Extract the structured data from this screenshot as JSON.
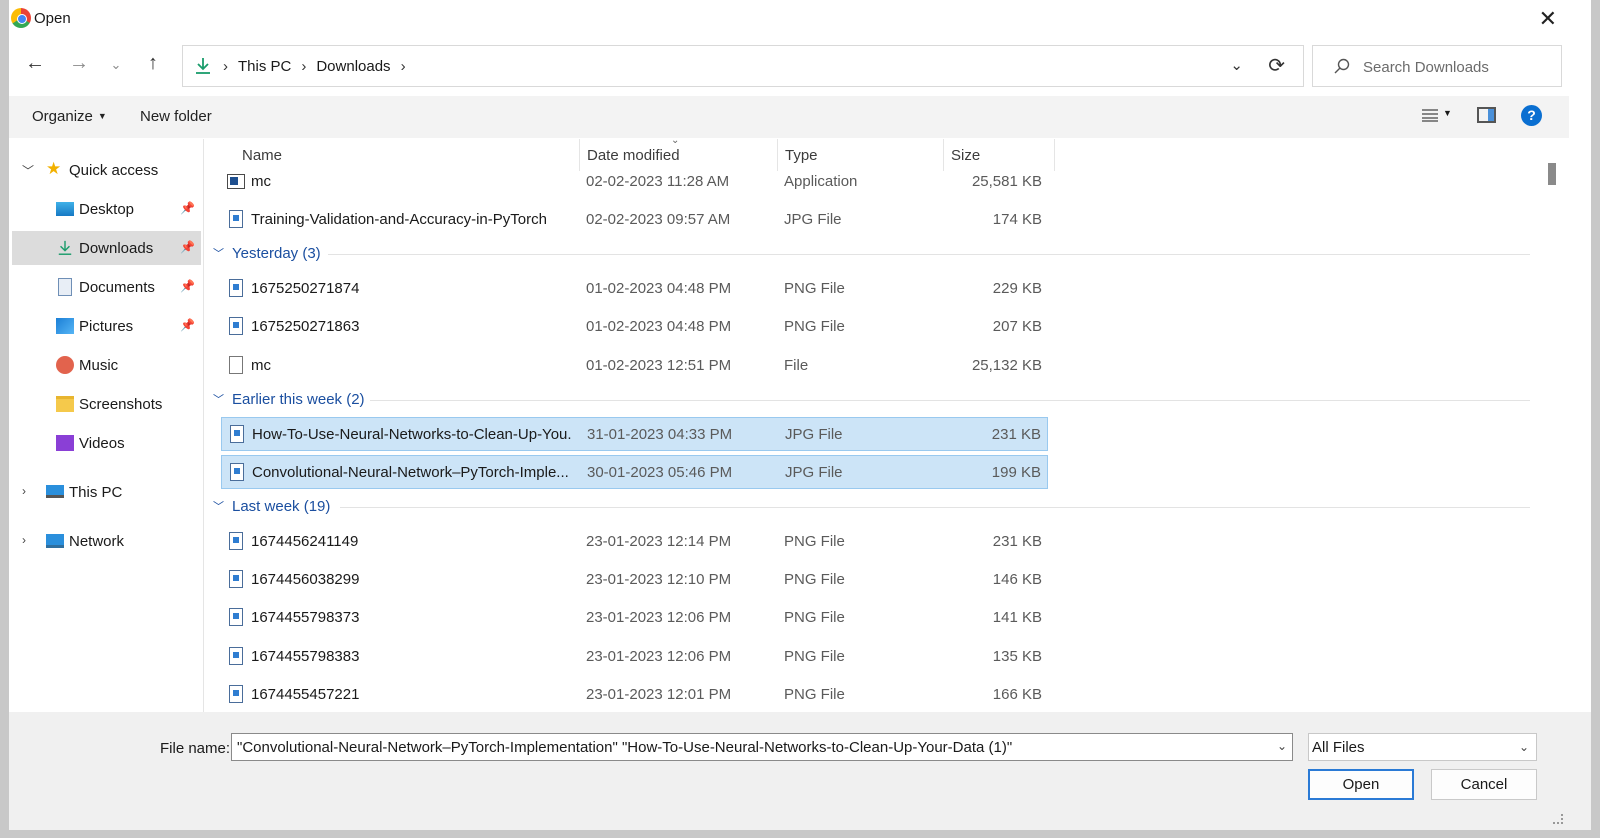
{
  "window": {
    "title": "Open",
    "close_icon": "close-icon"
  },
  "nav": {
    "breadcrumbs": [
      "This PC",
      "Downloads"
    ],
    "search_placeholder": "Search Downloads"
  },
  "toolbar": {
    "organize_label": "Organize",
    "new_folder_label": "New folder",
    "help_label": "?"
  },
  "sidebar": {
    "quick_access": "Quick access",
    "items": [
      {
        "label": "Desktop",
        "icon": "desktop-icon",
        "pinned": true
      },
      {
        "label": "Downloads",
        "icon": "download-icon",
        "pinned": true,
        "selected": true
      },
      {
        "label": "Documents",
        "icon": "document-icon",
        "pinned": true
      },
      {
        "label": "Pictures",
        "icon": "pictures-icon",
        "pinned": true
      },
      {
        "label": "Music",
        "icon": "music-icon",
        "pinned": false
      },
      {
        "label": "Screenshots",
        "icon": "folder-icon",
        "pinned": false
      },
      {
        "label": "Videos",
        "icon": "videos-icon",
        "pinned": false
      }
    ],
    "this_pc": "This PC",
    "network": "Network"
  },
  "columns": {
    "name": "Name",
    "date": "Date modified",
    "type": "Type",
    "size": "Size"
  },
  "top_rows": [
    {
      "name": "mc",
      "date": "02-02-2023 11:28 AM",
      "type": "Application",
      "size": "25,581 KB",
      "icon": "application-icon"
    },
    {
      "name": "Training-Validation-and-Accuracy-in-PyTorch",
      "date": "02-02-2023 09:57 AM",
      "type": "JPG File",
      "size": "174 KB",
      "icon": "image-file-icon"
    }
  ],
  "groups": {
    "yesterday": {
      "label": "Yesterday (3)",
      "rows": [
        {
          "name": "1675250271874",
          "date": "01-02-2023 04:48 PM",
          "type": "PNG File",
          "size": "229 KB",
          "icon": "image-file-icon"
        },
        {
          "name": "1675250271863",
          "date": "01-02-2023 04:48 PM",
          "type": "PNG File",
          "size": "207 KB",
          "icon": "image-file-icon"
        },
        {
          "name": "mc",
          "date": "01-02-2023 12:51 PM",
          "type": "File",
          "size": "25,132 KB",
          "icon": "blank-file-icon"
        }
      ]
    },
    "earlier": {
      "label": "Earlier this week (2)",
      "rows": [
        {
          "name": "How-To-Use-Neural-Networks-to-Clean-Up-You...",
          "date": "31-01-2023 04:33 PM",
          "type": "JPG File",
          "size": "231 KB",
          "icon": "image-file-icon",
          "selected": true
        },
        {
          "name": "Convolutional-Neural-Network–PyTorch-Imple...",
          "date": "30-01-2023 05:46 PM",
          "type": "JPG File",
          "size": "199 KB",
          "icon": "image-file-icon",
          "selected": true
        }
      ]
    },
    "lastweek": {
      "label": "Last week (19)",
      "rows": [
        {
          "name": "1674456241149",
          "date": "23-01-2023 12:14 PM",
          "type": "PNG File",
          "size": "231 KB",
          "icon": "image-file-icon"
        },
        {
          "name": "1674456038299",
          "date": "23-01-2023 12:10 PM",
          "type": "PNG File",
          "size": "146 KB",
          "icon": "image-file-icon"
        },
        {
          "name": "1674455798373",
          "date": "23-01-2023 12:06 PM",
          "type": "PNG File",
          "size": "141 KB",
          "icon": "image-file-icon"
        },
        {
          "name": "1674455798383",
          "date": "23-01-2023 12:06 PM",
          "type": "PNG File",
          "size": "135 KB",
          "icon": "image-file-icon"
        },
        {
          "name": "1674455457221",
          "date": "23-01-2023 12:01 PM",
          "type": "PNG File",
          "size": "166 KB",
          "icon": "image-file-icon"
        }
      ]
    }
  },
  "footer": {
    "file_name_label": "File name:",
    "file_name_value": "\"Convolutional-Neural-Network–PyTorch-Implementation\" \"How-To-Use-Neural-Networks-to-Clean-Up-Your-Data (1)\"",
    "filter_value": "All Files",
    "open_label": "Open",
    "cancel_label": "Cancel"
  },
  "colors": {
    "selection_bg": "#cce4f7",
    "group_header": "#1b4fa0",
    "accent": "#2a7ad5"
  }
}
